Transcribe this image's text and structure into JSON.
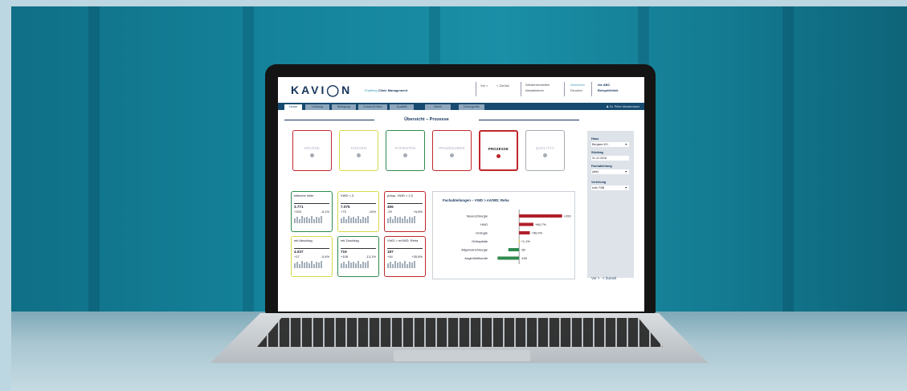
{
  "header": {
    "logo": "KAVI◯N",
    "slogan_prefix": "Enabling",
    "slogan": "Clinic Management",
    "nav_forward": "Vor  >",
    "nav_back": "<  Zurück",
    "restore": "Wiederherstellen",
    "refresh": "Aktualisieren",
    "favorites": "Abmelden",
    "print": "Drucken",
    "clinic_line1": "die ABC",
    "clinic_line2": "Beispielklinik"
  },
  "tabs": [
    "Home",
    "Leistung",
    "Belegung",
    "Kosten/Erlöse",
    "Qualität",
    "Markt",
    "Demografie"
  ],
  "user": "Dr. Peter Mustermann",
  "page_title": "Übersicht – Prozesse",
  "process_boxes": [
    {
      "label": "ERLÖSE",
      "color": "#c0262b"
    },
    {
      "label": "KOSTEN",
      "color": "#d7d94a"
    },
    {
      "label": "PATIENTEN",
      "color": "#2f8a4e"
    },
    {
      "label": "PROZEDUREN",
      "color": "#c0262b"
    },
    {
      "label": "PROZESSE",
      "color": "#c0262b"
    },
    {
      "label": "QUALITÄT",
      "color": "#a6acb3"
    }
  ],
  "kpis": [
    {
      "name": "kritische Inlier",
      "value": "3.771",
      "delta": "+204",
      "pct": "-5,1%",
      "color": "#2f8a4e"
    },
    {
      "name": "VWD < 3",
      "value": "7.075",
      "delta": "+73",
      "pct": "-10%",
      "color": "#d7d94a"
    },
    {
      "name": "präop. VWD > 1,5",
      "value": "455",
      "delta": "-29",
      "pct": "+6,8%",
      "color": "#c0262b"
    },
    {
      "name": "mit Abschlag",
      "value": "4.037",
      "delta": "+17",
      "pct": "-0,4%",
      "color": "#d7d94a"
    },
    {
      "name": "mit Zuschlag",
      "value": "719",
      "delta": "+108",
      "pct": "-13,1%",
      "color": "#2f8a4e"
    },
    {
      "name": "VWD > mVWD; Reha",
      "value": "187",
      "delta": "+44",
      "pct": "+30,8%",
      "color": "#c0262b"
    }
  ],
  "chart_data": {
    "type": "bar",
    "orientation": "horizontal",
    "title": "Fachabteilungen – VWD > mVWD; Reha",
    "categories": [
      "Neurochirurgie",
      "HNO",
      "Urologie",
      "Orthopädie",
      "Allgemeinchirurgie",
      "Augenheilkunde"
    ],
    "values": [
      200,
      66.7,
      50.0,
      1.1,
      -50,
      -100
    ],
    "labels": [
      "+200",
      "+66,7%",
      "+50,0%",
      "+1,1%",
      "-50",
      "-100"
    ],
    "colors": [
      "#b11f2a",
      "#b11f2a",
      "#b11f2a",
      "#e6d84a",
      "#2f8a4e",
      "#2f8a4e"
    ],
    "xlim": [
      -120,
      220
    ]
  },
  "filters": [
    {
      "label": "Haus",
      "value": "Bergsee-KH",
      "dropdown": true
    },
    {
      "label": "Stichtag",
      "value": "31.12.2016",
      "dropdown": false
    },
    {
      "label": "Fachabteilung",
      "value": "(alle)",
      "dropdown": true
    },
    {
      "label": "Verteilung",
      "value": "exkl. FAB",
      "dropdown": true
    }
  ],
  "pager": {
    "forward": "Vor  >",
    "back": "<  Zurück"
  },
  "caret": "▼"
}
